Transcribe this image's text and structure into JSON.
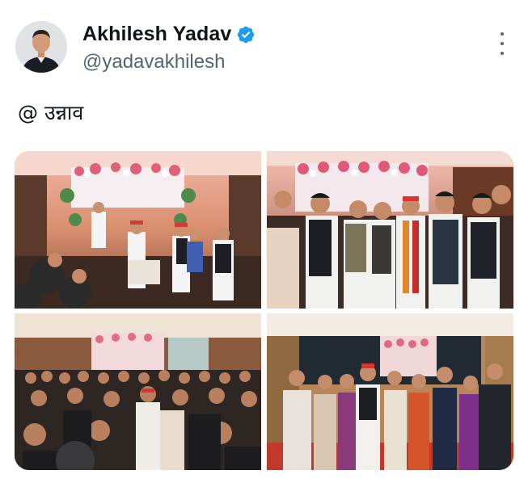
{
  "tweet": {
    "author": {
      "display_name": "Akhilesh Yadav",
      "handle": "@yadavakhilesh",
      "verified": true,
      "avatar_icon": "profile-photo"
    },
    "text": "@ उन्नाव",
    "more_icon": "more-vertical-icon",
    "media": [
      {
        "label": "photo-1",
        "scene": "stage with floral decoration, seated guests"
      },
      {
        "label": "photo-2",
        "scene": "group standing in front of floral stage"
      },
      {
        "label": "photo-3",
        "scene": "crowd in banquet hall"
      },
      {
        "label": "photo-4",
        "scene": "group photo with couple on stage"
      }
    ]
  },
  "colors": {
    "verified_blue": "#1d9bf0",
    "text_primary": "#0f1419",
    "text_secondary": "#536471"
  }
}
